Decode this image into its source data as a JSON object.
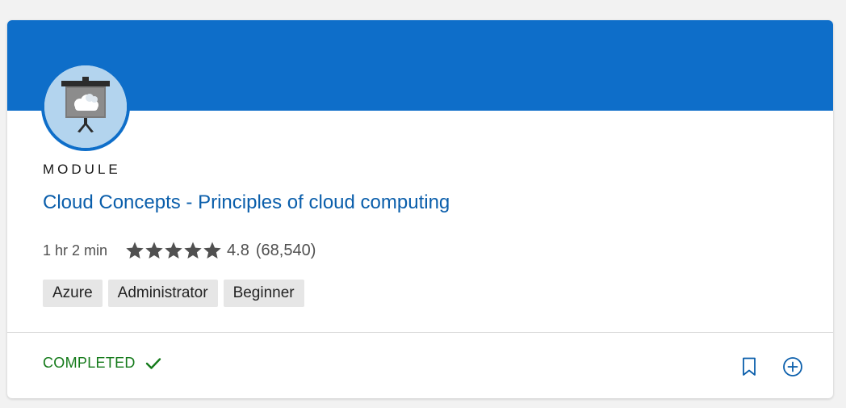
{
  "card": {
    "eyebrow": "MODULE",
    "title": "Cloud Concepts - Principles of cloud computing",
    "duration": "1 hr 2 min",
    "rating": "4.8",
    "rating_count": "(68,540)",
    "stars_filled": 5,
    "tags": [
      "Azure",
      "Administrator",
      "Beginner"
    ],
    "status": "COMPLETED",
    "icons": {
      "module": "presentation-board-cloud-icon",
      "status": "check-icon",
      "bookmark": "bookmark-icon",
      "add": "add-circle-icon"
    }
  },
  "colors": {
    "banner": "#0e6ec9",
    "title": "#0a5eab",
    "status": "#147a1a",
    "tag_bg": "#e6e6e6"
  }
}
